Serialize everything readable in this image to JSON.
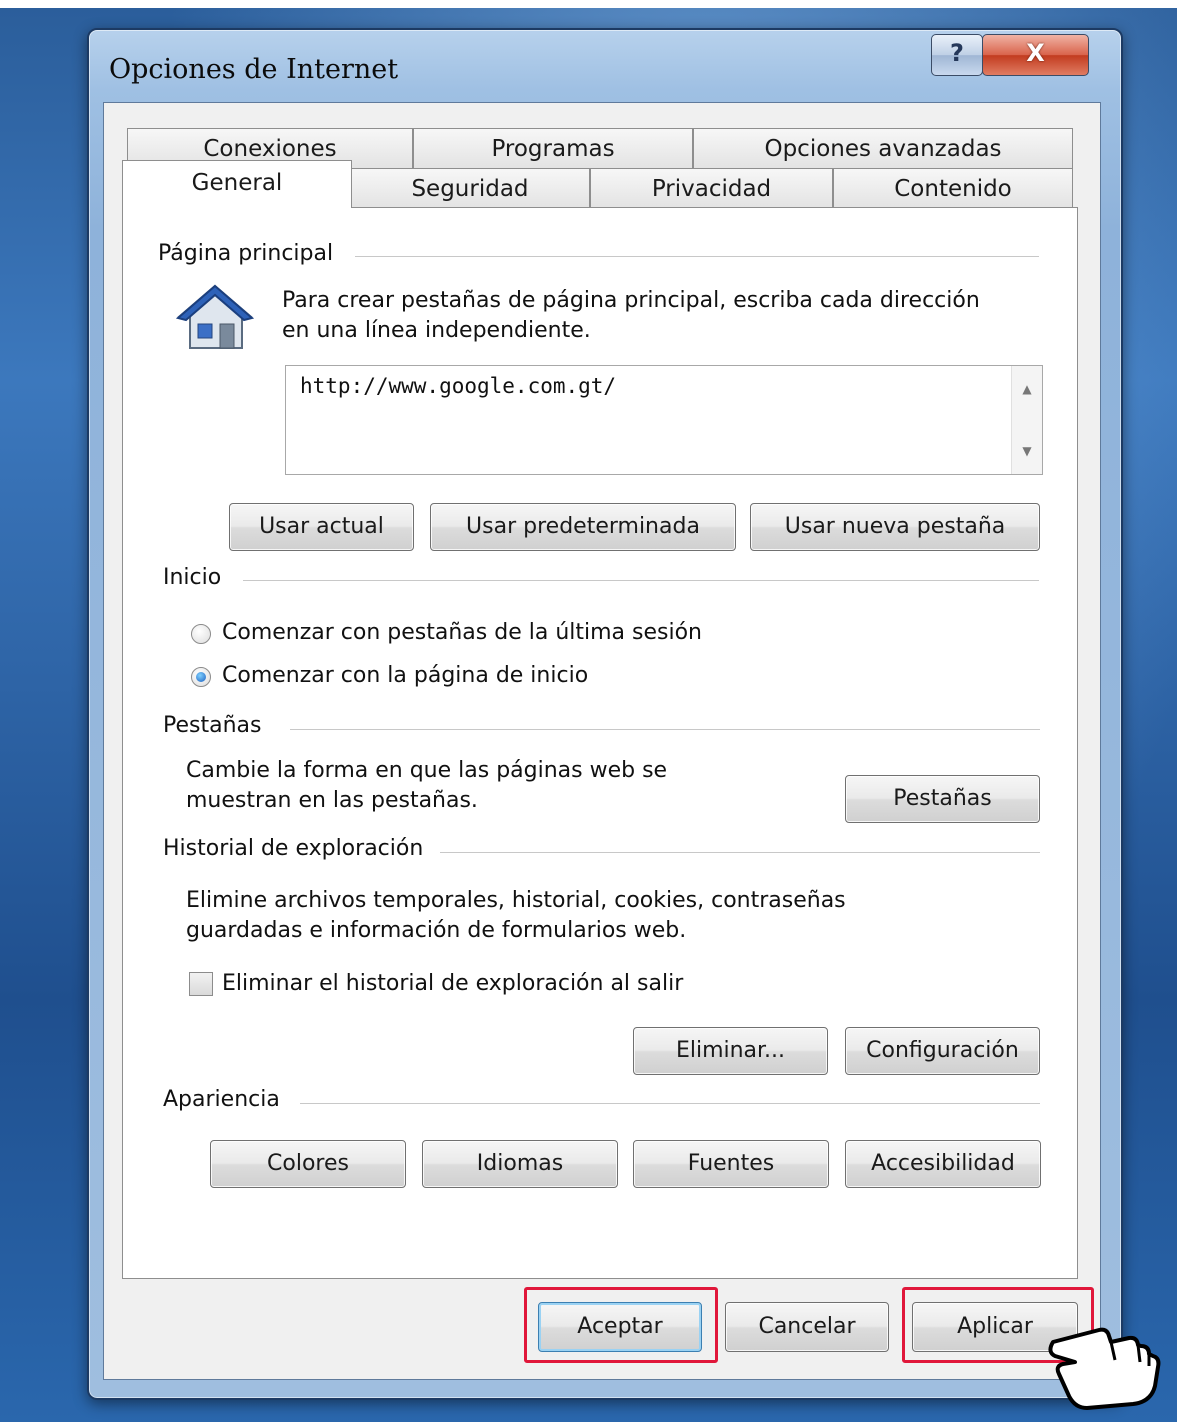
{
  "window": {
    "title": "Opciones de Internet",
    "help_label": "?",
    "close_label": "X"
  },
  "tabs": {
    "row1": [
      "Conexiones",
      "Programas",
      "Opciones avanzadas"
    ],
    "row2": [
      "General",
      "Seguridad",
      "Privacidad",
      "Contenido"
    ],
    "active": "General"
  },
  "home": {
    "group_label": "Página principal",
    "instructions_line1": "Para crear pestañas de página principal, escriba cada dirección",
    "instructions_line2": "en una línea independiente.",
    "url_value": "http://www.google.com.gt/",
    "buttons": [
      "Usar actual",
      "Usar predeterminada",
      "Usar nueva pestaña"
    ]
  },
  "startup": {
    "group_label": "Inicio",
    "options": [
      {
        "label": "Comenzar con pestañas de la última sesión",
        "selected": false
      },
      {
        "label": "Comenzar con la página de inicio",
        "selected": true
      }
    ]
  },
  "tabs_section": {
    "group_label": "Pestañas",
    "desc_line1": "Cambie la forma en que las páginas web se",
    "desc_line2": "muestran en las pestañas.",
    "button": "Pestañas"
  },
  "history": {
    "group_label": "Historial de exploración",
    "desc_line1": "Elimine archivos temporales, historial, cookies, contraseñas",
    "desc_line2": "guardadas e información de formularios web.",
    "checkbox_label": "Eliminar el historial de exploración al salir",
    "checkbox_checked": false,
    "delete_button": "Eliminar...",
    "settings_button": "Configuración"
  },
  "appearance": {
    "group_label": "Apariencia",
    "buttons": [
      "Colores",
      "Idiomas",
      "Fuentes",
      "Accesibilidad"
    ]
  },
  "footer": {
    "accept": "Aceptar",
    "cancel": "Cancelar",
    "apply": "Aplicar"
  },
  "colors": {
    "highlight": "#e0173a",
    "desktop": "#2b5e9b"
  }
}
